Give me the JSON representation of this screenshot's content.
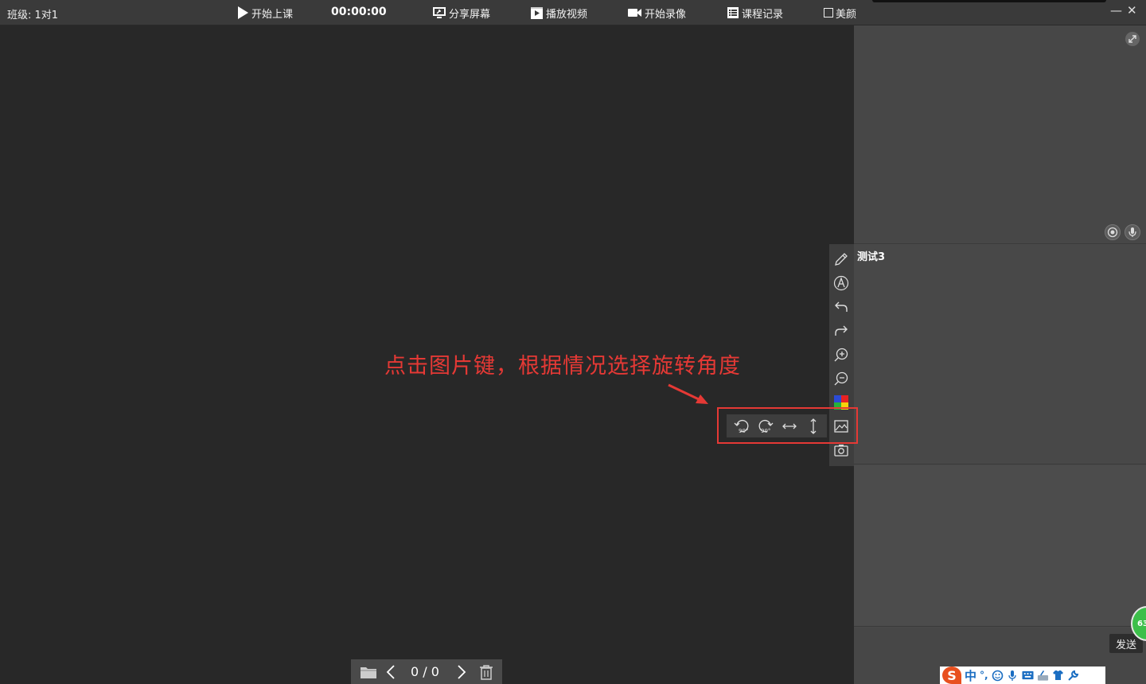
{
  "app": {
    "class_label": "班级: 1对1",
    "timer": "00:00:00"
  },
  "toolbar": {
    "start_class": "开始上课",
    "share_screen": "分享屏幕",
    "play_video": "播放视频",
    "start_record": "开始录像",
    "course_record": "课程记录",
    "beauty": "美颜"
  },
  "window": {
    "minimize": "—",
    "close": "✕"
  },
  "right_panel": {
    "student_name": "测试3",
    "send_label": "发送",
    "badge_value": "63"
  },
  "annotation": {
    "text": "点击图片键，根据情况选择旋转角度",
    "color": "#e53935"
  },
  "pager": {
    "page_text": "0 / 0"
  },
  "ime": {
    "logo": "S",
    "mode": "中",
    "punct": "°,"
  },
  "colors": {
    "background": "#282828",
    "topbar": "#3a3a3a",
    "panel": "#4a4a4a",
    "highlight": "#e53935"
  },
  "icons": {
    "vertical_toolbar": [
      "pencil-icon",
      "text-icon",
      "undo-icon",
      "redo-icon",
      "zoom-in-icon",
      "zoom-out-icon",
      "color-palette-icon",
      "image-icon",
      "camera-icon"
    ],
    "image_subtoolbar": [
      "rotate-left-90-icon",
      "rotate-right-90-icon",
      "flip-horizontal-icon",
      "flip-vertical-icon"
    ]
  }
}
